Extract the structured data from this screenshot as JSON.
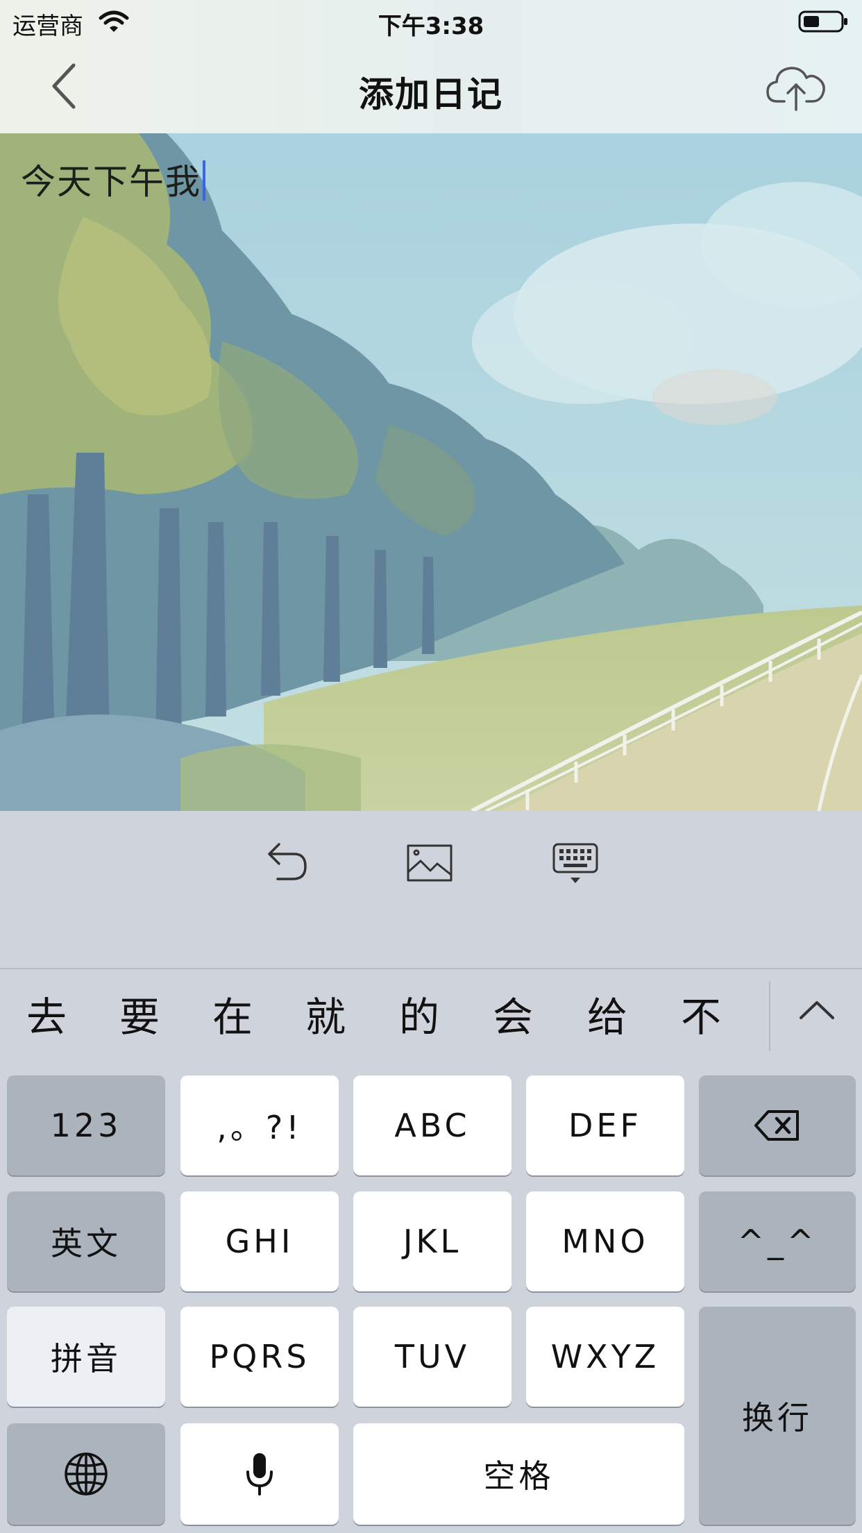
{
  "status_bar": {
    "carrier": "运营商",
    "time": "下午3:38",
    "icons": [
      "wifi-icon",
      "battery-icon"
    ]
  },
  "nav": {
    "title": "添加日记",
    "back_icon": "chevron-left-icon",
    "upload_icon": "cloud-upload-icon"
  },
  "editor": {
    "content": "今天下午我",
    "background": "painted landscape with trees, meadow and fence",
    "cursor_color": "#3a63e8"
  },
  "toolbar": {
    "icons": [
      "undo-icon",
      "image-icon",
      "keyboard-hide-icon"
    ]
  },
  "candidates": [
    "去",
    "要",
    "在",
    "就",
    "的",
    "会",
    "给",
    "不"
  ],
  "keyboard": {
    "rows": [
      [
        "123",
        ",。?!",
        "ABC",
        "DEF",
        "⌫"
      ],
      [
        "英文",
        "GHI",
        "JKL",
        "MNO",
        "^_^"
      ],
      [
        "拼音",
        "PQRS",
        "TUV",
        "WXYZ",
        "换行"
      ],
      [
        "🌐",
        "🎤",
        "空格"
      ]
    ],
    "k123": "123",
    "punct": ",。?!",
    "abc": "ABC",
    "def": "DEF",
    "english": "英文",
    "ghi": "GHI",
    "jkl": "JKL",
    "mno": "MNO",
    "emoticon": "^_^",
    "pinyin": "拼音",
    "pqrs": "PQRS",
    "tuv": "TUV",
    "wxyz": "WXYZ",
    "return": "换行",
    "space": "空格",
    "icons": [
      "delete-icon",
      "globe-icon",
      "microphone-icon",
      "chevron-up-icon"
    ]
  },
  "colors": {
    "key_light": "#ffffff",
    "key_dark": "#abb3bd",
    "keyboard_bg": "#cfd4dc"
  }
}
